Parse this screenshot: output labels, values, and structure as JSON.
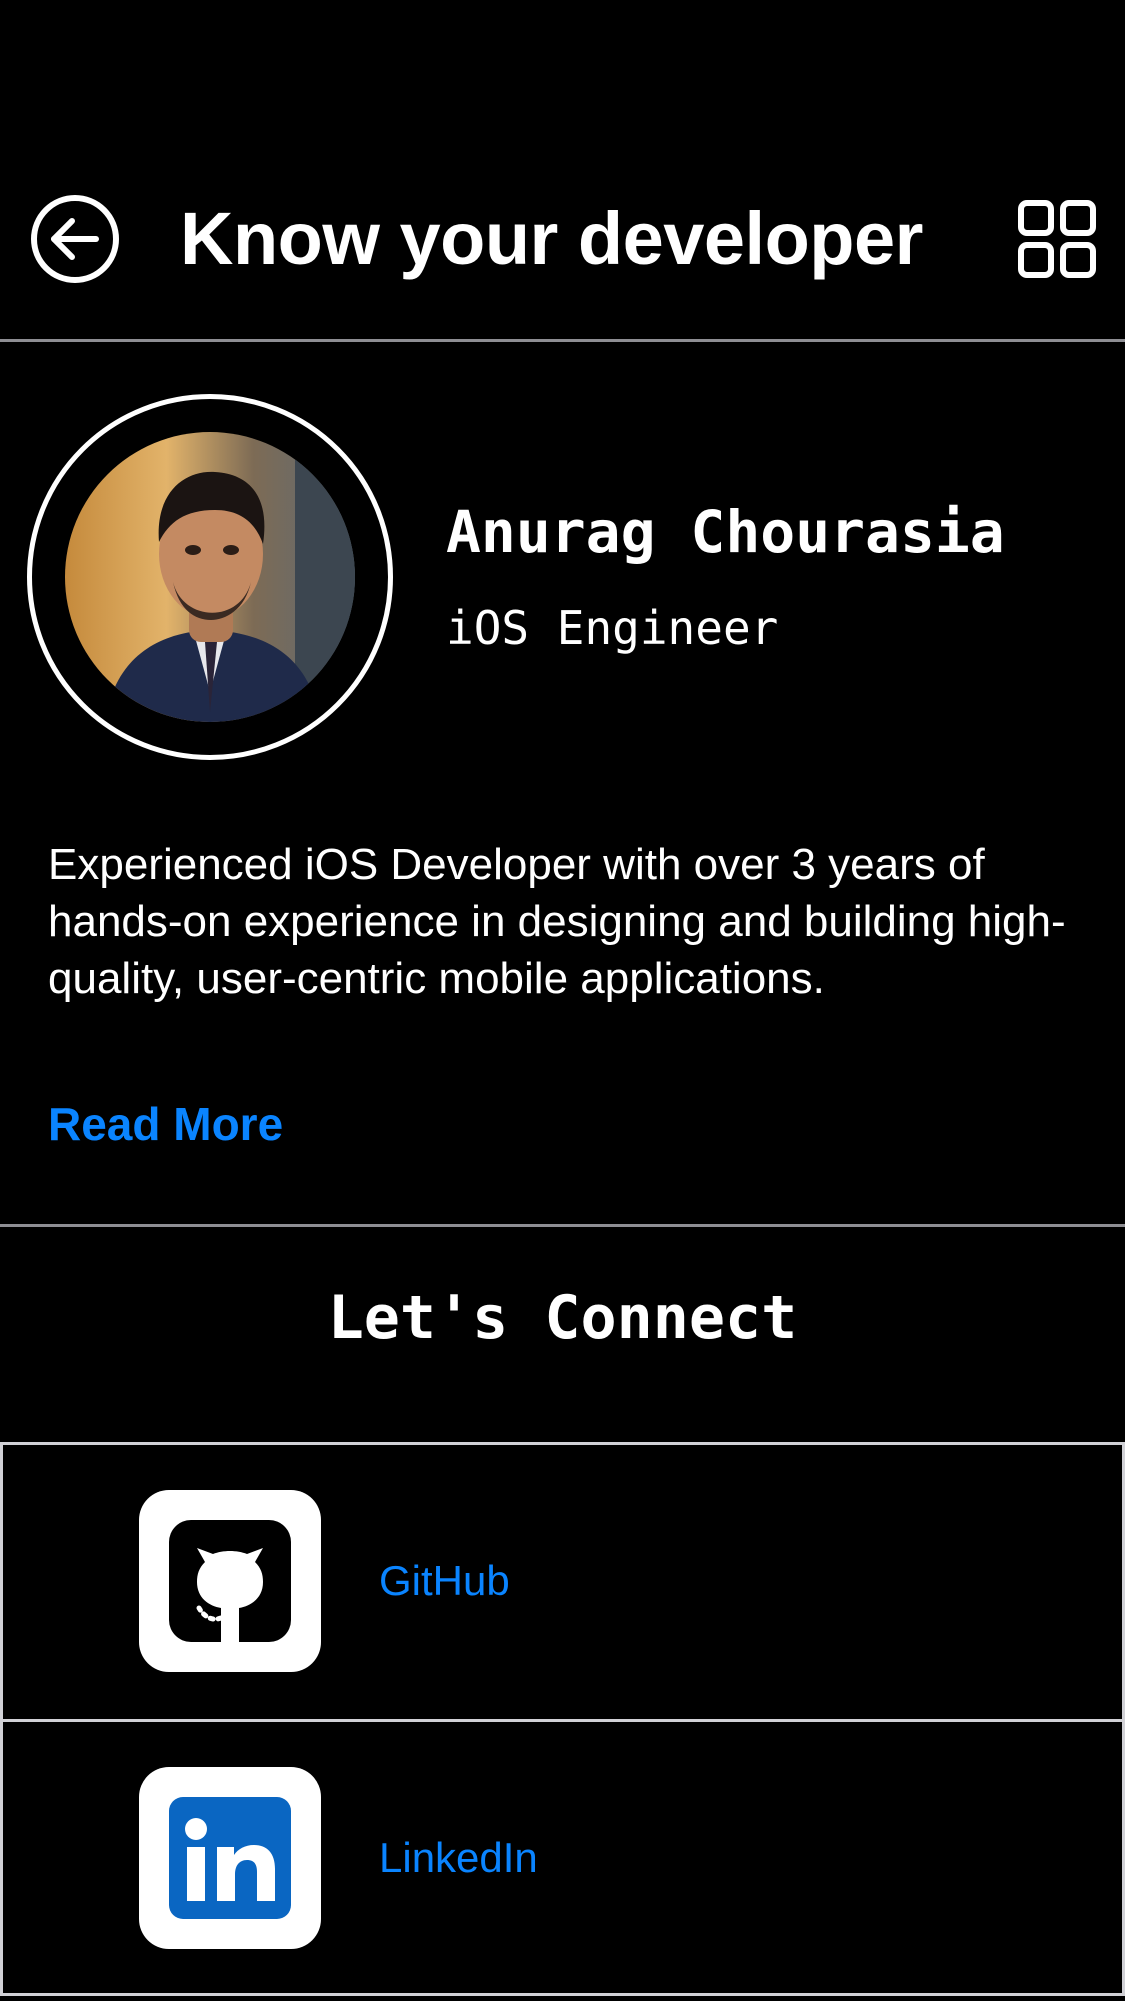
{
  "header": {
    "title": "Know your developer",
    "back_icon": "arrow-left-circle-icon",
    "menu_icon": "grid-icon"
  },
  "profile": {
    "name": "Anurag Chourasia",
    "role": "iOS Engineer",
    "bio": "Experienced iOS Developer with over 3 years of hands-on experience in designing and building high-quality, user-centric mobile applications.",
    "read_more_label": "Read More"
  },
  "connect": {
    "title": "Let's Connect",
    "links": [
      {
        "label": "GitHub",
        "icon": "github-icon"
      },
      {
        "label": "LinkedIn",
        "icon": "linkedin-icon"
      }
    ]
  },
  "colors": {
    "background": "#000000",
    "accent": "#0A84FF",
    "divider": "#8E8E93",
    "linkedin": "#0A66C2"
  }
}
